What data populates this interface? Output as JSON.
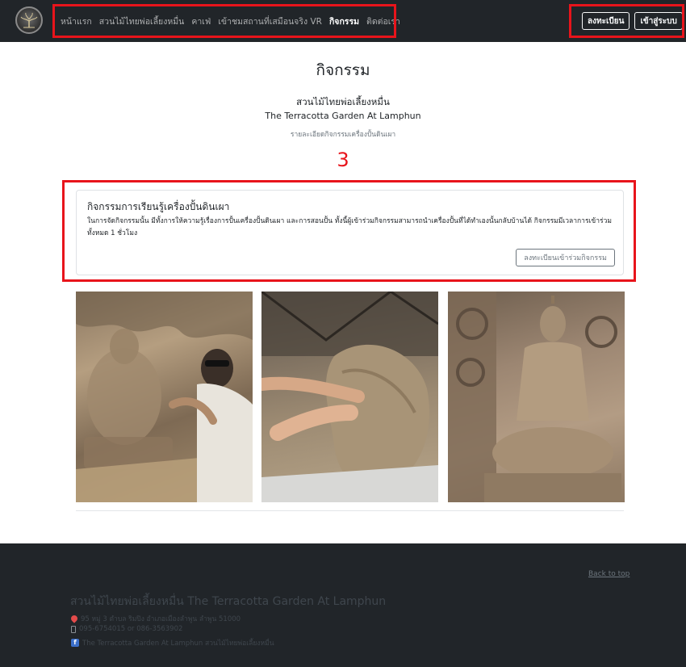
{
  "nav": {
    "links": [
      "หน้าแรก",
      "สวนไม้ไทยพ่อเลี้ยงหมื่น",
      "คาเฟ่",
      "เข้าชมสถานที่เสมือนจริง VR",
      "กิจกรรม",
      "ติดต่อเรา"
    ],
    "active_link": "กิจกรรม",
    "register_label": "ลงทะเบียน",
    "login_label": "เข้าสู่ระบบ"
  },
  "page": {
    "title": "กิจกรรม",
    "garden_name_th": "สวนไม้ไทยพ่อเลี้ยงหมื่น",
    "garden_name_en": "The Terracotta Garden At Lamphun",
    "subtitle": "รายละเอียดกิจกรรมเครื่องปั้นดินเผา",
    "annotation_number": "3"
  },
  "activity": {
    "title": "กิจกรรมการเรียนรู้เครื่องปั้นดินเผา",
    "description": "ในการจัดกิจกรรมนั้น มีทั้งการให้ความรู้เรื่องการปั้นเครื่องปั้นดินเผา และการสอนปั้น ทั้งนี้ผู้เข้าร่วมกิจกรรมสามารถนำเครื่องปั้นที่ได้ทำเองนั้นกลับบ้านได้ กิจกรรมมีเวลาการเข้าร่วมทั้งหมด 1 ชั่วโมง",
    "register_button": "ลงทะเบียนเข้าร่วมกิจกรรม"
  },
  "colors": {
    "highlight": "#e8141b",
    "navbar_bg": "#212529",
    "footer_text": "#3f464d"
  },
  "footer": {
    "back_to_top": "Back to top",
    "title": "สวนไม้ไทยพ่อเลี้ยงหมื่น The Terracotta Garden At Lamphun",
    "address": "95 หมู่ 3 ตำบล ริมปิง อำเภอเมืองลำพูน ลำพูน 51000",
    "phone": "095-6754015 or 086-3563902",
    "facebook": "The Terracotta Garden At Lamphun สวนไม้ไทยพ่อเลี้ยงหมื่น"
  }
}
